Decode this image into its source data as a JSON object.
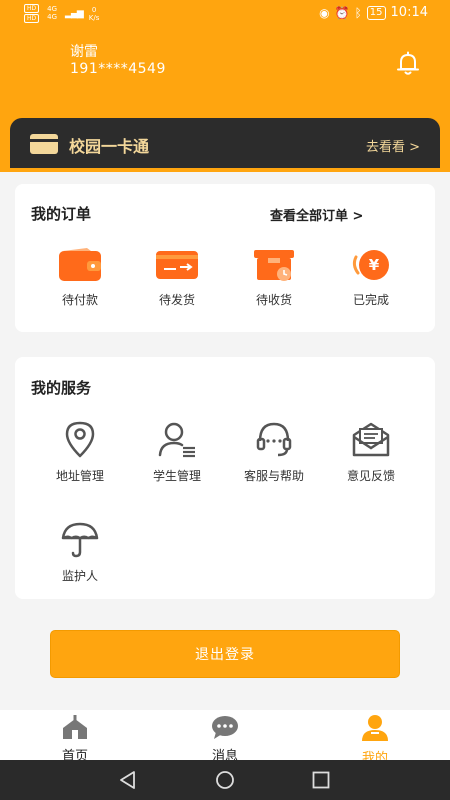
{
  "status_bar": {
    "sim_labels": [
      "HD",
      "HD"
    ],
    "signal_labels": [
      "4G",
      "4G"
    ],
    "net_speed_value": "0",
    "net_speed_unit": "K/s",
    "battery": "15",
    "time": "10:14"
  },
  "user": {
    "name": "谢雷",
    "phone": "191****4549"
  },
  "card": {
    "title": "校园一卡通",
    "link": "去看看 >"
  },
  "orders": {
    "title": "我的订单",
    "view_all": "查看全部订单 >",
    "items": [
      {
        "label": "待付款",
        "icon": "wallet-icon"
      },
      {
        "label": "待发货",
        "icon": "card-ship-icon"
      },
      {
        "label": "待收货",
        "icon": "parcel-clock-icon"
      },
      {
        "label": "已完成",
        "icon": "yen-coin-icon"
      }
    ]
  },
  "services": {
    "title": "我的服务",
    "items": [
      {
        "label": "地址管理",
        "icon": "location-pin-icon"
      },
      {
        "label": "学生管理",
        "icon": "user-list-icon"
      },
      {
        "label": "客服与帮助",
        "icon": "headset-icon"
      },
      {
        "label": "意见反馈",
        "icon": "envelope-icon"
      },
      {
        "label": "监护人",
        "icon": "umbrella-icon"
      }
    ]
  },
  "logout_label": "退出登录",
  "tabs": [
    {
      "label": "首页",
      "icon": "home-icon",
      "active": false
    },
    {
      "label": "消息",
      "icon": "chat-icon",
      "active": false
    },
    {
      "label": "我的",
      "icon": "profile-icon",
      "active": true
    }
  ],
  "colors": {
    "brand": "#ffa50f",
    "card_bg": "#2c2c2c",
    "card_text": "#f3d79a",
    "icon_orange": "#ff6a1a"
  }
}
